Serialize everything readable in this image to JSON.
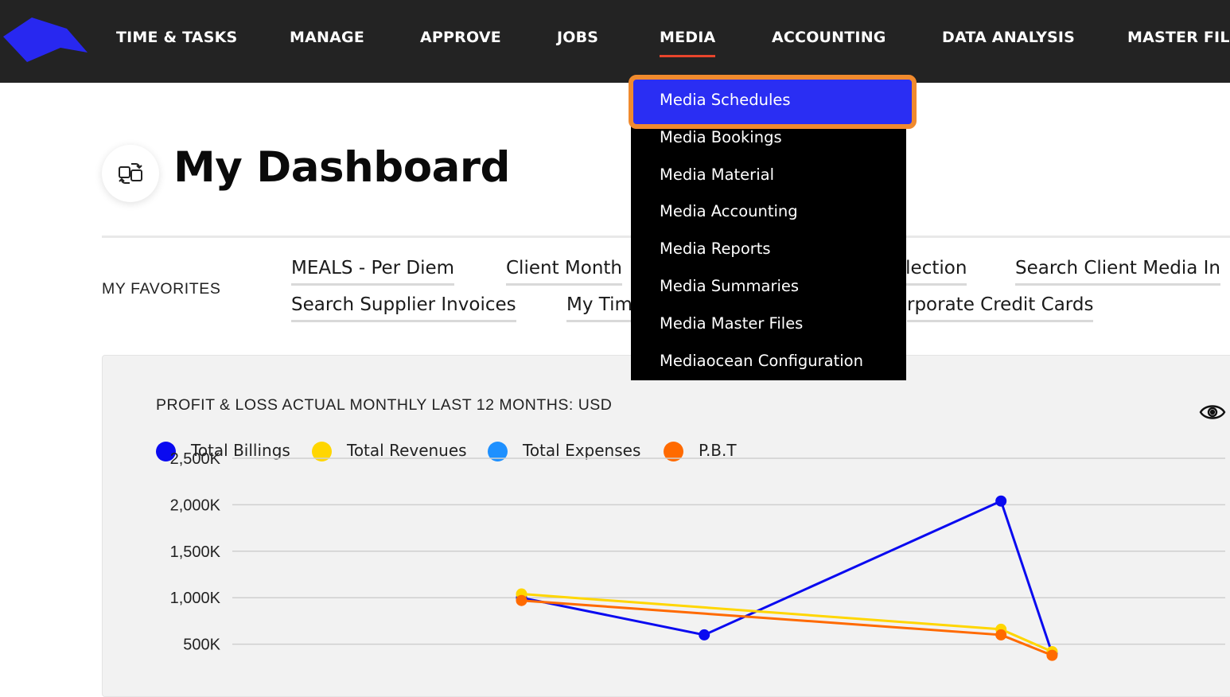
{
  "nav": {
    "items": [
      "TIME & TASKS",
      "MANAGE",
      "APPROVE",
      "JOBS",
      "MEDIA",
      "ACCOUNTING",
      "DATA ANALYSIS",
      "MASTER FIL"
    ],
    "active": "MEDIA"
  },
  "dropdown": {
    "items": [
      "Media Schedules",
      "Media Bookings",
      "Media Material",
      "Media Accounting",
      "Media Reports",
      "Media Summaries",
      "Media Master Files",
      "Mediaocean Configuration"
    ],
    "selected": "Media Schedules"
  },
  "page": {
    "title": "My Dashboard"
  },
  "favorites": {
    "label": "MY FAVORITES",
    "links": [
      "MEALS - Per Diem",
      "Client Month",
      "election",
      "Search Client Media In",
      "Search Supplier Invoices",
      "My Tim",
      "rporate Credit Cards"
    ]
  },
  "chart_data": {
    "type": "line",
    "title": "PROFIT & LOSS ACTUAL MONTHLY LAST 12 MONTHS: USD",
    "yticks": [
      "2,500K",
      "2,000K",
      "1,500K",
      "1,000K",
      "500K"
    ],
    "ylim": [
      0,
      2500
    ],
    "legend_placement": "top-left",
    "grid": true,
    "series": [
      {
        "name": "Total Billings",
        "color": "#0a0af0",
        "points": [
          [
            3,
            1000
          ],
          [
            4.86,
            600
          ],
          [
            7.88,
            2040
          ],
          [
            8.4,
            400
          ]
        ]
      },
      {
        "name": "Total Revenues",
        "color": "#ffd600",
        "points": [
          [
            3,
            1040
          ],
          [
            7.88,
            660
          ],
          [
            8.4,
            420
          ]
        ]
      },
      {
        "name": "Total Expenses",
        "color": "#1e90ff",
        "points": []
      },
      {
        "name": "P.B.T",
        "color": "#ff6a00",
        "points": [
          [
            3,
            970
          ],
          [
            7.88,
            600
          ],
          [
            8.4,
            380
          ]
        ]
      }
    ]
  }
}
